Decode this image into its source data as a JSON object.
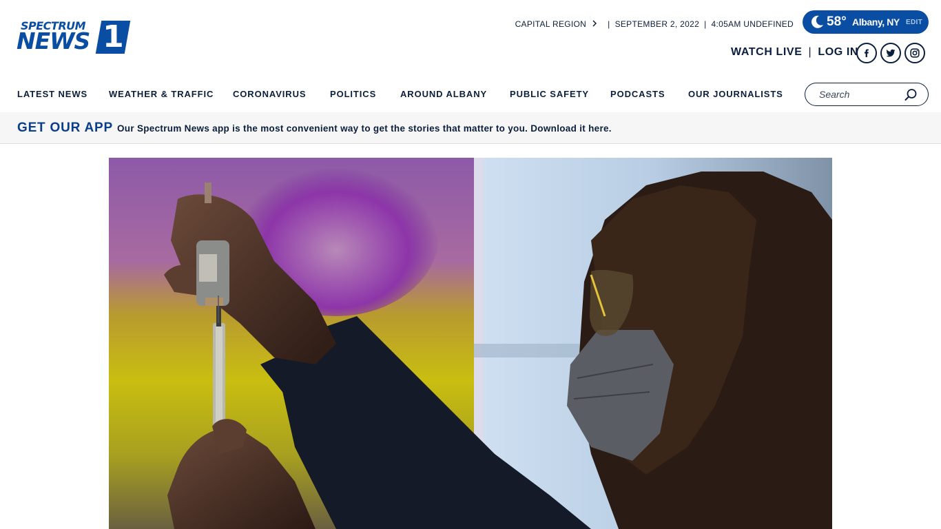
{
  "logo": {
    "line1": "SPECTRUM",
    "line2": "NEWS",
    "number": "1"
  },
  "topbar": {
    "region": "CAPITAL REGION",
    "date": "SEPTEMBER 2, 2022",
    "time": "4:05AM UNDEFINED"
  },
  "weather": {
    "temp": "58°",
    "location": "Albany, NY",
    "edit_label": "EDIT",
    "icon": "moon-icon"
  },
  "actions": {
    "watch_live": "WATCH LIVE",
    "divider": "|",
    "log_in": "LOG IN"
  },
  "social": [
    "facebook-icon",
    "twitter-icon",
    "instagram-icon"
  ],
  "nav": {
    "items": [
      {
        "label": "LATEST NEWS"
      },
      {
        "label": "WEATHER & TRAFFIC"
      },
      {
        "label": "CORONAVIRUS"
      },
      {
        "label": "POLITICS"
      },
      {
        "label": "AROUND ALBANY"
      },
      {
        "label": "PUBLIC SAFETY"
      },
      {
        "label": "PODCASTS"
      },
      {
        "label": "OUR JOURNALISTS"
      }
    ],
    "search_placeholder": "Search"
  },
  "app_banner": {
    "title": "GET OUR APP",
    "message": "Our Spectrum News app is the most convenient way to get the stories that matter to you. Download it here."
  },
  "colors": {
    "brand_blue": "#0a4ea3",
    "navy_text": "#0b1e3d",
    "banner_title": "#0a3e8a"
  }
}
